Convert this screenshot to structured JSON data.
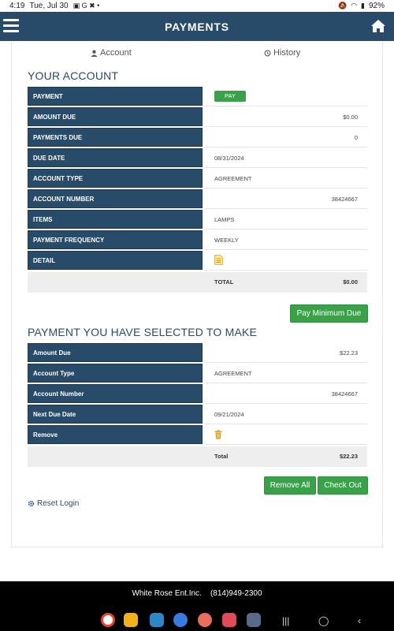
{
  "status": {
    "time": "4:19",
    "date": "Tue, Jul 30",
    "battery": "92%"
  },
  "header": {
    "title": "PAYMENTS"
  },
  "tabs": {
    "account": "Account",
    "history": "History"
  },
  "account": {
    "title": "YOUR ACCOUNT",
    "rows": [
      {
        "label": "PAYMENT",
        "button": "PAY"
      },
      {
        "label": "AMOUNT DUE",
        "value": "$0.00"
      },
      {
        "label": "PAYMENTS DUE",
        "value": "0"
      },
      {
        "label": "DUE DATE",
        "value": "08/31/2024"
      },
      {
        "label": "ACCOUNT TYPE",
        "value": "AGREEMENT"
      },
      {
        "label": "ACCOUNT NUMBER",
        "value": "38424667"
      },
      {
        "label": "ITEMS",
        "value": "LAMPS"
      },
      {
        "label": "PAYMENT FREQUENCY",
        "value": "WEEKLY"
      },
      {
        "label": "DETAIL",
        "icon": "document-icon"
      }
    ],
    "total_label": "TOTAL",
    "total_value": "$0.00",
    "pay_min_label": "Pay Minimum Due"
  },
  "selected": {
    "title": "PAYMENT YOU HAVE SELECTED TO MAKE",
    "rows": [
      {
        "label": "Amount Due",
        "value": "$22.23"
      },
      {
        "label": "Account Type",
        "value": "AGREEMENT"
      },
      {
        "label": "Account Number",
        "value": "38424667"
      },
      {
        "label": "Next Due Date",
        "value": "09/21/2024"
      },
      {
        "label": "Remove",
        "icon": "trash-icon"
      }
    ],
    "total_label": "Total",
    "total_value": "$22.23",
    "remove_all_label": "Remove All",
    "checkout_label": "Check Out"
  },
  "reset_login": "Reset Login",
  "footer": {
    "company": "White Rose Ent.Inc.",
    "phone": "(814)949-2300"
  },
  "colors": {
    "header": "#294b6a",
    "accent_green": "#3aa14a",
    "footer": "#000000"
  }
}
